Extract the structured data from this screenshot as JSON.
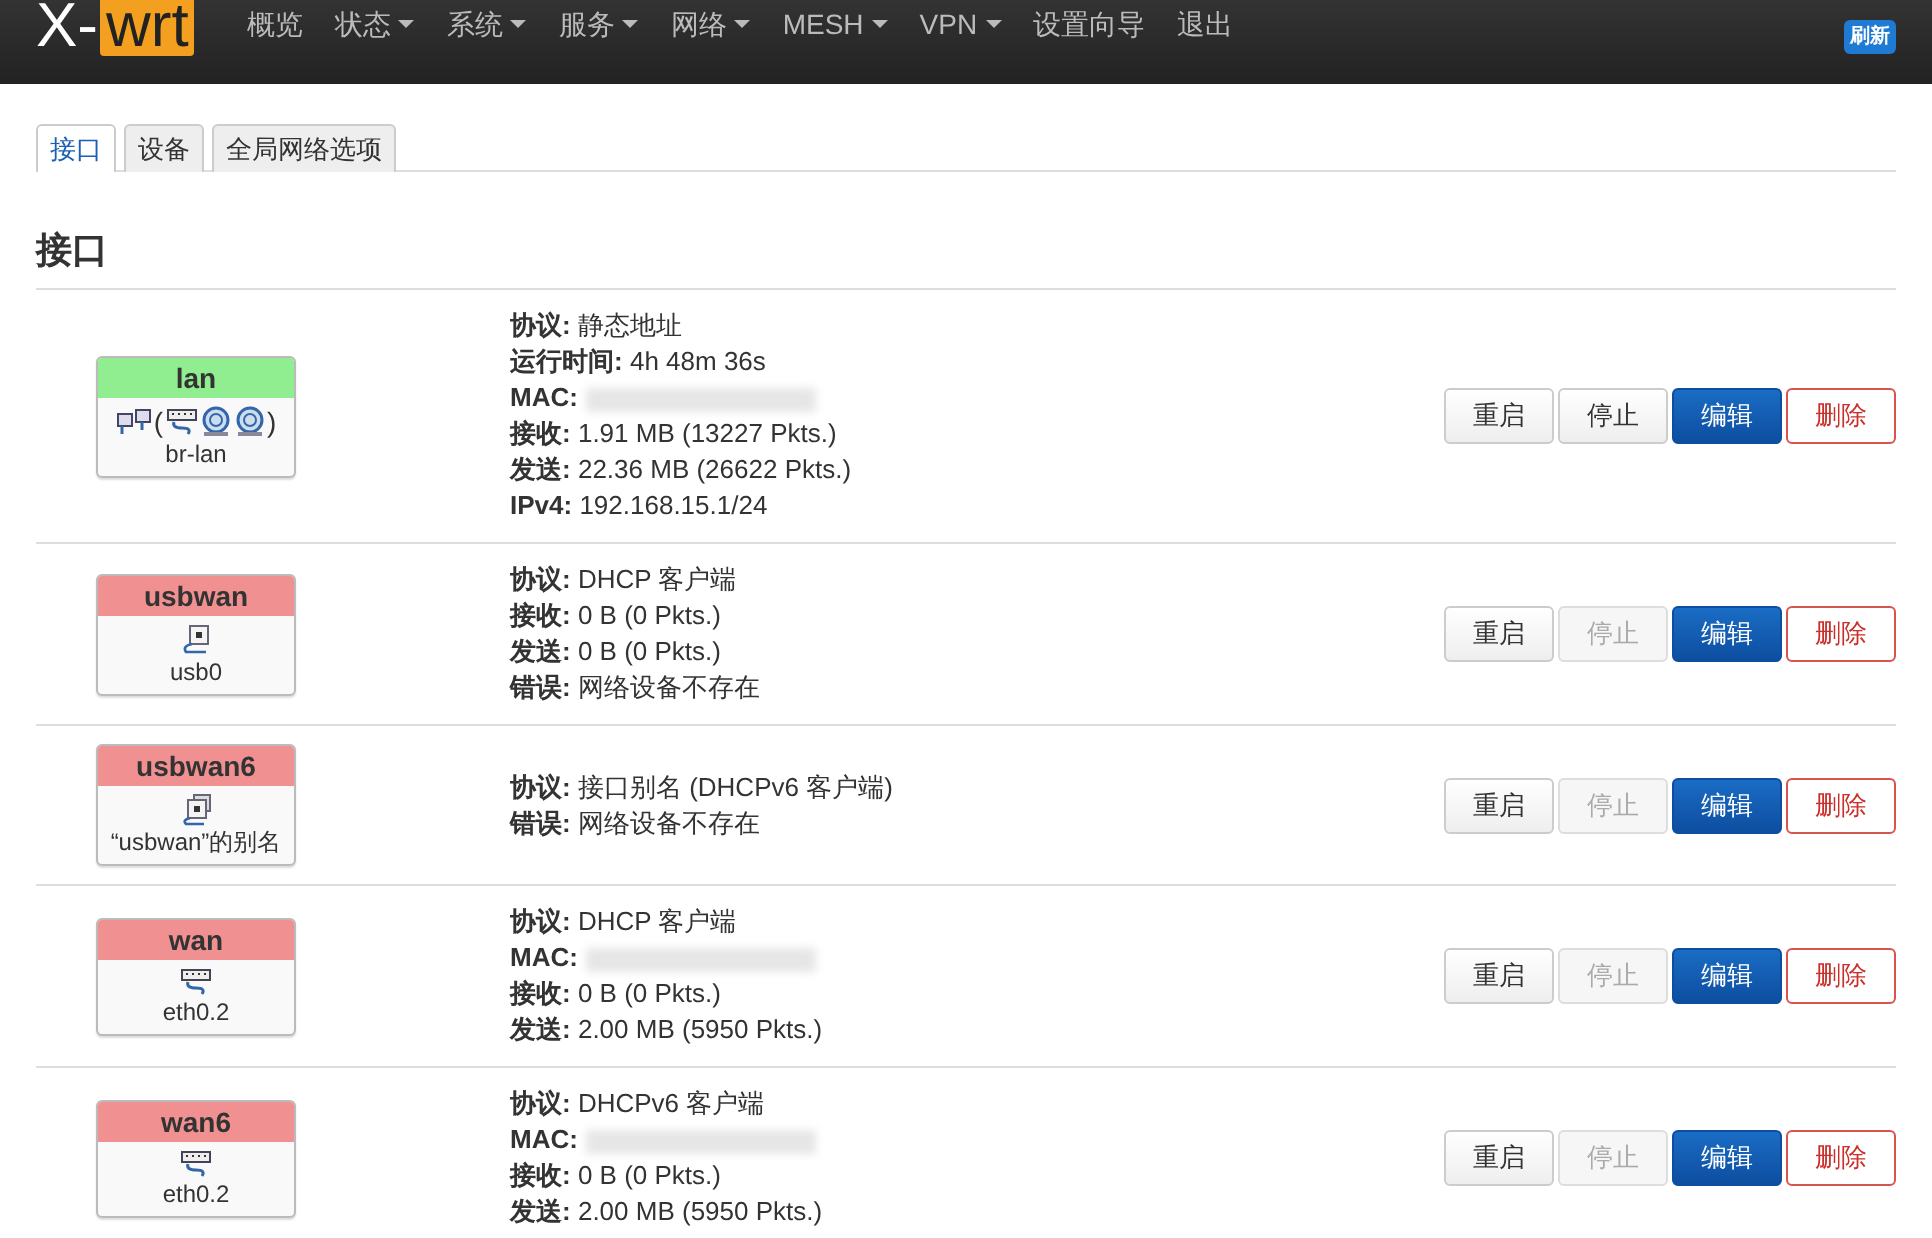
{
  "navbar": {
    "logo": {
      "left": "X-",
      "right": "wrt"
    },
    "menu": [
      {
        "label": "概览",
        "dropdown": false
      },
      {
        "label": "状态",
        "dropdown": true
      },
      {
        "label": "系统",
        "dropdown": true
      },
      {
        "label": "服务",
        "dropdown": true
      },
      {
        "label": "网络",
        "dropdown": true
      },
      {
        "label": "MESH",
        "dropdown": true
      },
      {
        "label": "VPN",
        "dropdown": true
      },
      {
        "label": "设置向导",
        "dropdown": false
      },
      {
        "label": "退出",
        "dropdown": false
      }
    ],
    "refresh_badge": "刷新"
  },
  "tabs": [
    {
      "label": "接口",
      "selected": true
    },
    {
      "label": "设备",
      "selected": false
    },
    {
      "label": "全局网络选项",
      "selected": false
    }
  ],
  "heading": "接口",
  "interfaces": [
    {
      "name": "lan",
      "color": "#90ee90",
      "icons": [
        {
          "kind": "bridge"
        },
        {
          "kind": "text",
          "text": "("
        },
        {
          "kind": "switch"
        },
        {
          "kind": "wifi"
        },
        {
          "kind": "wifi"
        },
        {
          "kind": "text",
          "text": ")"
        }
      ],
      "device": "br-lan",
      "lines": [
        {
          "kind": "text",
          "label": "协议:",
          "value": "静态地址"
        },
        {
          "kind": "text",
          "label": "运行时间:",
          "value": "4h 48m 36s"
        },
        {
          "kind": "blurred",
          "label": "MAC:"
        },
        {
          "kind": "text",
          "label": "接收:",
          "value": "1.91 MB (13227 Pkts.)"
        },
        {
          "kind": "text",
          "label": "发送:",
          "value": "22.36 MB (26622 Pkts.)"
        },
        {
          "kind": "text",
          "label": "IPv4:",
          "value": "192.168.15.1/24"
        }
      ],
      "buttons": [
        {
          "kind": "default",
          "label": "重启",
          "disabled": false
        },
        {
          "kind": "default",
          "label": "停止",
          "disabled": false
        },
        {
          "kind": "primary",
          "label": "编辑",
          "disabled": false
        },
        {
          "kind": "danger",
          "label": "删除",
          "disabled": false
        }
      ]
    },
    {
      "name": "usbwan",
      "color": "#f09090",
      "icons": [
        {
          "kind": "port"
        }
      ],
      "device": "usb0",
      "lines": [
        {
          "kind": "text",
          "label": "协议:",
          "value": "DHCP 客户端"
        },
        {
          "kind": "text",
          "label": "接收:",
          "value": "0 B (0 Pkts.)"
        },
        {
          "kind": "text",
          "label": "发送:",
          "value": "0 B (0 Pkts.)"
        },
        {
          "kind": "text",
          "label": "错误:",
          "value": "网络设备不存在"
        }
      ],
      "buttons": [
        {
          "kind": "default",
          "label": "重启",
          "disabled": false
        },
        {
          "kind": "default",
          "label": "停止",
          "disabled": true
        },
        {
          "kind": "primary",
          "label": "编辑",
          "disabled": false
        },
        {
          "kind": "danger",
          "label": "删除",
          "disabled": false
        }
      ]
    },
    {
      "name": "usbwan6",
      "color": "#f09090",
      "icons": [
        {
          "kind": "alias"
        }
      ],
      "device": "“usbwan”的别名",
      "lines": [
        {
          "kind": "text",
          "label": "协议:",
          "value": "接口别名 (DHCPv6 客户端)"
        },
        {
          "kind": "text",
          "label": "错误:",
          "value": "网络设备不存在"
        }
      ],
      "buttons": [
        {
          "kind": "default",
          "label": "重启",
          "disabled": false
        },
        {
          "kind": "default",
          "label": "停止",
          "disabled": true
        },
        {
          "kind": "primary",
          "label": "编辑",
          "disabled": false
        },
        {
          "kind": "danger",
          "label": "删除",
          "disabled": false
        }
      ]
    },
    {
      "name": "wan",
      "color": "#f09090",
      "icons": [
        {
          "kind": "switch"
        }
      ],
      "device": "eth0.2",
      "lines": [
        {
          "kind": "text",
          "label": "协议:",
          "value": "DHCP 客户端"
        },
        {
          "kind": "blurred",
          "label": "MAC:"
        },
        {
          "kind": "text",
          "label": "接收:",
          "value": "0 B (0 Pkts.)"
        },
        {
          "kind": "text",
          "label": "发送:",
          "value": "2.00 MB (5950 Pkts.)"
        }
      ],
      "buttons": [
        {
          "kind": "default",
          "label": "重启",
          "disabled": false
        },
        {
          "kind": "default",
          "label": "停止",
          "disabled": true
        },
        {
          "kind": "primary",
          "label": "编辑",
          "disabled": false
        },
        {
          "kind": "danger",
          "label": "删除",
          "disabled": false
        }
      ]
    },
    {
      "name": "wan6",
      "color": "#f09090",
      "icons": [
        {
          "kind": "switch"
        }
      ],
      "device": "eth0.2",
      "lines": [
        {
          "kind": "text",
          "label": "协议:",
          "value": "DHCPv6 客户端"
        },
        {
          "kind": "blurred",
          "label": "MAC:"
        },
        {
          "kind": "text",
          "label": "接收:",
          "value": "0 B (0 Pkts.)"
        },
        {
          "kind": "text",
          "label": "发送:",
          "value": "2.00 MB (5950 Pkts.)"
        }
      ],
      "buttons": [
        {
          "kind": "default",
          "label": "重启",
          "disabled": false
        },
        {
          "kind": "default",
          "label": "停止",
          "disabled": true
        },
        {
          "kind": "primary",
          "label": "编辑",
          "disabled": false
        },
        {
          "kind": "danger",
          "label": "删除",
          "disabled": false
        }
      ]
    }
  ]
}
